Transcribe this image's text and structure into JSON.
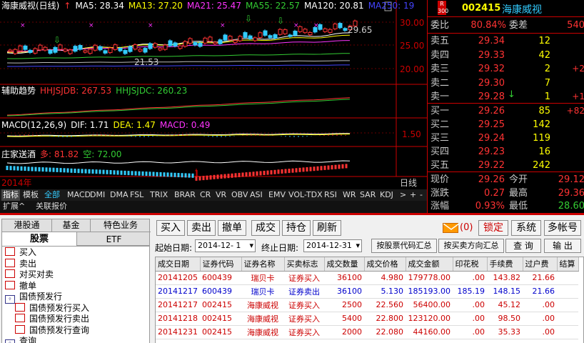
{
  "legend1": {
    "stock": "海康威视(日线)",
    "arrow": "↑",
    "ma5": "MA5: 28.34",
    "ma13": "MA13: 27.20",
    "ma21": "MA21: 25.47",
    "ma55": "MA55: 22.57",
    "ma120": "MA120: 20.81",
    "ma250": "MA250: 19"
  },
  "axis1": {
    "t30": "30.00",
    "t25": "25.00",
    "t20": "20.00",
    "hi": "29.65",
    "lo": "21.53"
  },
  "legend2": {
    "name": "辅助趋势",
    "a": "HHJSJDB: 267.53",
    "b": "HHJSJDC: 260.23"
  },
  "legend3": {
    "name": "MACD(12,26,9)",
    "dif": "DIF: 1.71",
    "dea": "DEA: 1.47",
    "macd": "MACD: 0.49"
  },
  "axis3": {
    "t150": "1.50"
  },
  "legend4": {
    "name": "庄家送酒",
    "duo": "多: 81.82",
    "kong": "空: 72.00"
  },
  "xaxis": {
    "year": "2014年",
    "month": "1",
    "period": "日线"
  },
  "colors": {
    "bg": "#000000",
    "red": "#ff3333",
    "green": "#33cc33",
    "yellow": "#ffff00",
    "white": "#ffffff",
    "magenta": "#ff33ff",
    "cyan": "#33ccff",
    "accent": "#cc0000"
  },
  "tabs1": [
    "指标",
    "模板",
    "全部",
    "MACD",
    "DMI",
    "DMA",
    "FSL",
    "TRIX",
    "BRAR",
    "CR",
    "VR",
    "OBV",
    "ASI",
    "EMV",
    "VOL-TDX",
    "RSI",
    "WR",
    "SAR",
    "KDJ",
    ">",
    "+",
    "-"
  ],
  "tabs2": [
    "扩展^",
    "关联报价"
  ],
  "quote": {
    "badge_r": "R",
    "badge_300": "300",
    "code": "002415",
    "name": "海康威视",
    "weibi_label": "委比",
    "weibi": "80.84%",
    "weicha_label": "委差",
    "weicha": "540",
    "sells": [
      {
        "label": "卖五",
        "price": "29.34",
        "vol": "12",
        "extra": ""
      },
      {
        "label": "卖四",
        "price": "29.33",
        "vol": "42",
        "extra": ""
      },
      {
        "label": "卖三",
        "price": "29.32",
        "vol": "2",
        "extra": "+2"
      },
      {
        "label": "卖二",
        "price": "29.30",
        "vol": "7",
        "extra": ""
      },
      {
        "label": "卖一",
        "price": "29.28",
        "vol": "1",
        "extra": "+1"
      }
    ],
    "sell1_arrow": "↓",
    "buys": [
      {
        "label": "买一",
        "price": "29.26",
        "vol": "85",
        "extra": "+82"
      },
      {
        "label": "买二",
        "price": "29.25",
        "vol": "142",
        "extra": ""
      },
      {
        "label": "买三",
        "price": "29.24",
        "vol": "119",
        "extra": ""
      },
      {
        "label": "买四",
        "price": "29.23",
        "vol": "16",
        "extra": ""
      },
      {
        "label": "买五",
        "price": "29.22",
        "vol": "242",
        "extra": ""
      }
    ],
    "bottom": [
      {
        "l1": "现价",
        "v1": "29.26",
        "l2": "今开",
        "v2": "29.12"
      },
      {
        "l1": "涨跌",
        "v1": "0.27",
        "l2": "最高",
        "v2": "29.36"
      },
      {
        "l1": "涨幅",
        "v1": "0.93%",
        "l2": "最低",
        "v2": "28.60"
      }
    ]
  },
  "leftTabs": {
    "a": "港股通",
    "b": "基金",
    "c": "特色业务",
    "d": "股票",
    "e": "ETF"
  },
  "tree": [
    {
      "icon": "BUY",
      "label": "买入"
    },
    {
      "icon": "SELL",
      "label": "卖出"
    },
    {
      "icon": "BUY",
      "label": "对买对卖"
    },
    {
      "icon": "BUY",
      "label": "撤单"
    },
    {
      "icon": "Q",
      "label": "国债预发行"
    },
    {
      "icon": "BUY",
      "label": "国债预发行买入"
    },
    {
      "icon": "SELL",
      "label": "国债预发行卖出"
    },
    {
      "icon": "BUY",
      "label": "国债预发行查询"
    },
    {
      "icon": "Q",
      "label": "查询"
    }
  ],
  "toolbar": {
    "buy": "买入",
    "sell": "卖出",
    "cancel": "撤单",
    "deal": "成交",
    "hold": "持仓",
    "refresh": "刷新",
    "mail": "(0)",
    "lock": "锁定",
    "system": "系统",
    "multi": "多帐号"
  },
  "filter": {
    "start_label": "起始日期:",
    "start": "2014-12- 1",
    "end_label": "终止日期:",
    "end": "2014-12-31",
    "by_code": "按股票代码汇总",
    "by_dir": "按买卖方向汇总",
    "query": "查 询",
    "export": "输 出"
  },
  "table": {
    "headers": [
      "成交日期",
      "证券代码",
      "证券名称",
      "买卖标志",
      "成交数量",
      "成交价格",
      "成交金额",
      "印花税",
      "手续费",
      "过户费",
      "结算"
    ],
    "rows": [
      {
        "date": "20141205",
        "code": "600439",
        "name": "瑞贝卡",
        "dir": "证券买入",
        "qty": "36100",
        "price": "4.980",
        "amount": "179778.00",
        "tax": ".00",
        "fee": "143.82",
        "trans": "21.66",
        "side": "buy"
      },
      {
        "date": "20141217",
        "code": "600439",
        "name": "瑞贝卡",
        "dir": "证券卖出",
        "qty": "36100",
        "price": "5.130",
        "amount": "185193.00",
        "tax": "185.19",
        "fee": "148.15",
        "trans": "21.66",
        "side": "sell"
      },
      {
        "date": "20141217",
        "code": "002415",
        "name": "海康威视",
        "dir": "证券买入",
        "qty": "2500",
        "price": "22.560",
        "amount": "56400.00",
        "tax": ".00",
        "fee": "45.12",
        "trans": ".00",
        "side": "buy"
      },
      {
        "date": "20141218",
        "code": "002415",
        "name": "海康威视",
        "dir": "证券买入",
        "qty": "5400",
        "price": "22.800",
        "amount": "123120.00",
        "tax": ".00",
        "fee": "98.50",
        "trans": ".00",
        "side": "buy"
      },
      {
        "date": "20141231",
        "code": "002415",
        "name": "海康威视",
        "dir": "证券买入",
        "qty": "2000",
        "price": "22.080",
        "amount": "44160.00",
        "tax": ".00",
        "fee": "35.33",
        "trans": ".00",
        "side": "buy"
      }
    ]
  }
}
